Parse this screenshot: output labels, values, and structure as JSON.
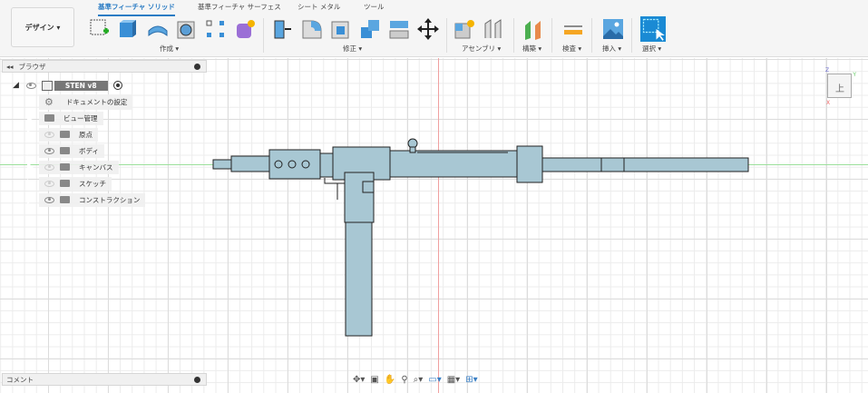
{
  "toolbar": {
    "design_label": "デザイン ▾",
    "tabs": [
      "基準フィーチャ ソリッド",
      "基準フィーチャ サーフェス",
      "シート メタル",
      "ツール"
    ],
    "groups": [
      "作成 ▾",
      "修正 ▾",
      "アセンブリ ▾",
      "構築 ▾",
      "検査 ▾",
      "挿入 ▾",
      "選択 ▾"
    ]
  },
  "browser": {
    "title": "ブラウザ",
    "root": "STEN v8",
    "items": [
      {
        "label": "ドキュメントの設定",
        "icon": "gear-icon"
      },
      {
        "label": "ビュー管理",
        "icon": "folder-icon"
      },
      {
        "label": "原点",
        "visible": false
      },
      {
        "label": "ボディ",
        "visible": true
      },
      {
        "label": "キャンバス",
        "visible": false
      },
      {
        "label": "スケッチ",
        "visible": false
      },
      {
        "label": "コンストラクション",
        "visible": true
      }
    ]
  },
  "comments": {
    "title": "コメント"
  },
  "viewcube": {
    "face": "上",
    "z": "Z",
    "y": "Y",
    "x": "X"
  },
  "colors": {
    "accent": "#2b7cc4",
    "model": "#a8c7d3"
  }
}
